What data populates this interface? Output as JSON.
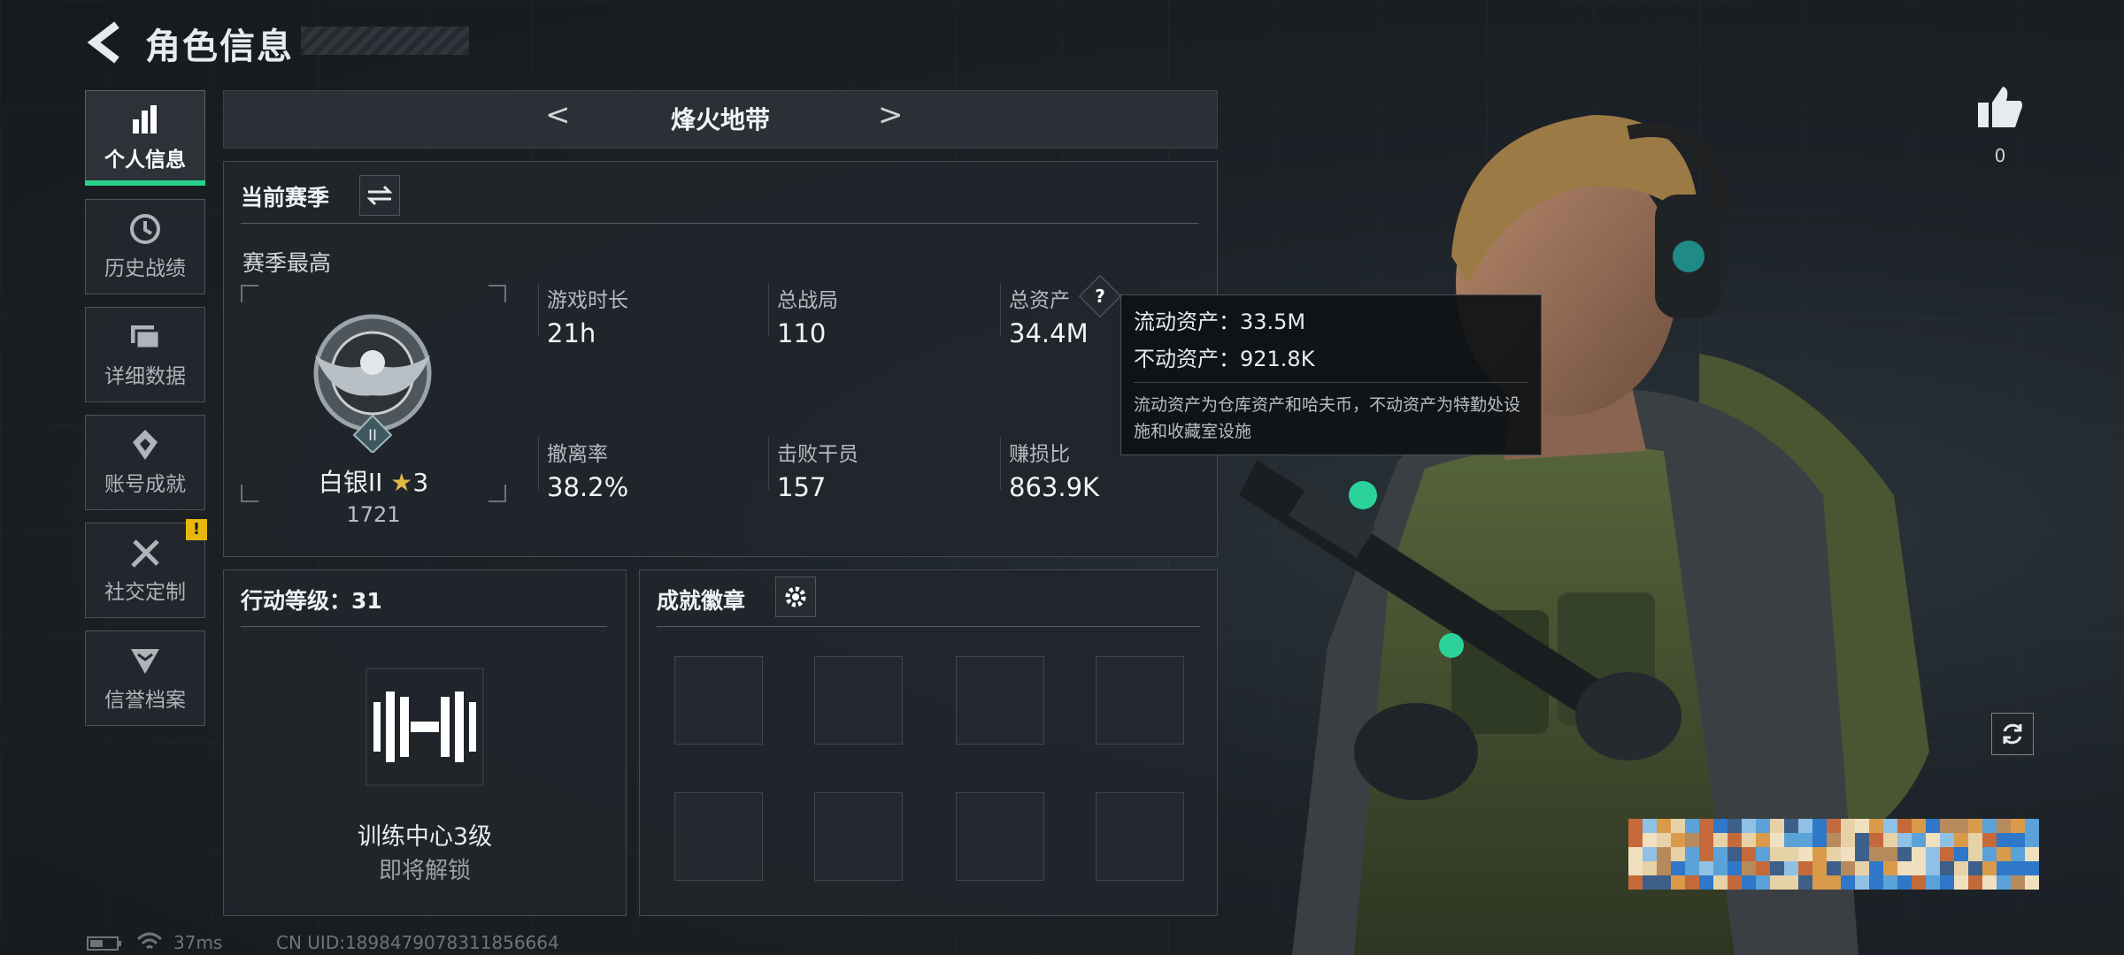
{
  "header": {
    "title": "角色信息"
  },
  "sidebar": {
    "items": [
      {
        "label": "个人信息",
        "icon": "bar-chart-icon",
        "active": true
      },
      {
        "label": "历史战绩",
        "icon": "history-clock-icon"
      },
      {
        "label": "详细数据",
        "icon": "cards-icon"
      },
      {
        "label": "账号成就",
        "icon": "medal-icon"
      },
      {
        "label": "社交定制",
        "icon": "tools-icon",
        "alert": "!"
      },
      {
        "label": "信誉档案",
        "icon": "shield-chevron-icon"
      }
    ]
  },
  "mode_selector": {
    "title": "烽火地带",
    "prev": "<",
    "next": ">"
  },
  "season": {
    "title": "当前赛季",
    "subtitle": "赛季最高",
    "rank_name": "白银II",
    "rank_stars": "3",
    "rank_points": "1721",
    "rank_numeral": "II",
    "stats": [
      {
        "label": "游戏时长",
        "value": "21h"
      },
      {
        "label": "总战局",
        "value": "110"
      },
      {
        "label": "总资产",
        "value": "34.4M",
        "help": "?"
      },
      {
        "label": "撤离率",
        "value": "38.2%"
      },
      {
        "label": "击败干员",
        "value": "157"
      },
      {
        "label": "赚损比",
        "value": "863.9K"
      }
    ]
  },
  "tooltip": {
    "liquid": "流动资产：33.5M",
    "fixed": "不动资产：921.8K",
    "note": "流动资产为仓库资产和哈夫币，不动资产为特勤处设施和收藏室设施"
  },
  "action_level": {
    "title": "行动等级：31",
    "unlock_name": "训练中心3级",
    "unlock_status": "即将解锁"
  },
  "achievements": {
    "title": "成就徽章",
    "slots": 8
  },
  "likes": {
    "count": "0"
  },
  "status_bar": {
    "ping": "37ms",
    "uid": "CN UID:1898479078311856664"
  },
  "colors": {
    "accent": "#29d28c",
    "warning": "#e6b80f"
  }
}
